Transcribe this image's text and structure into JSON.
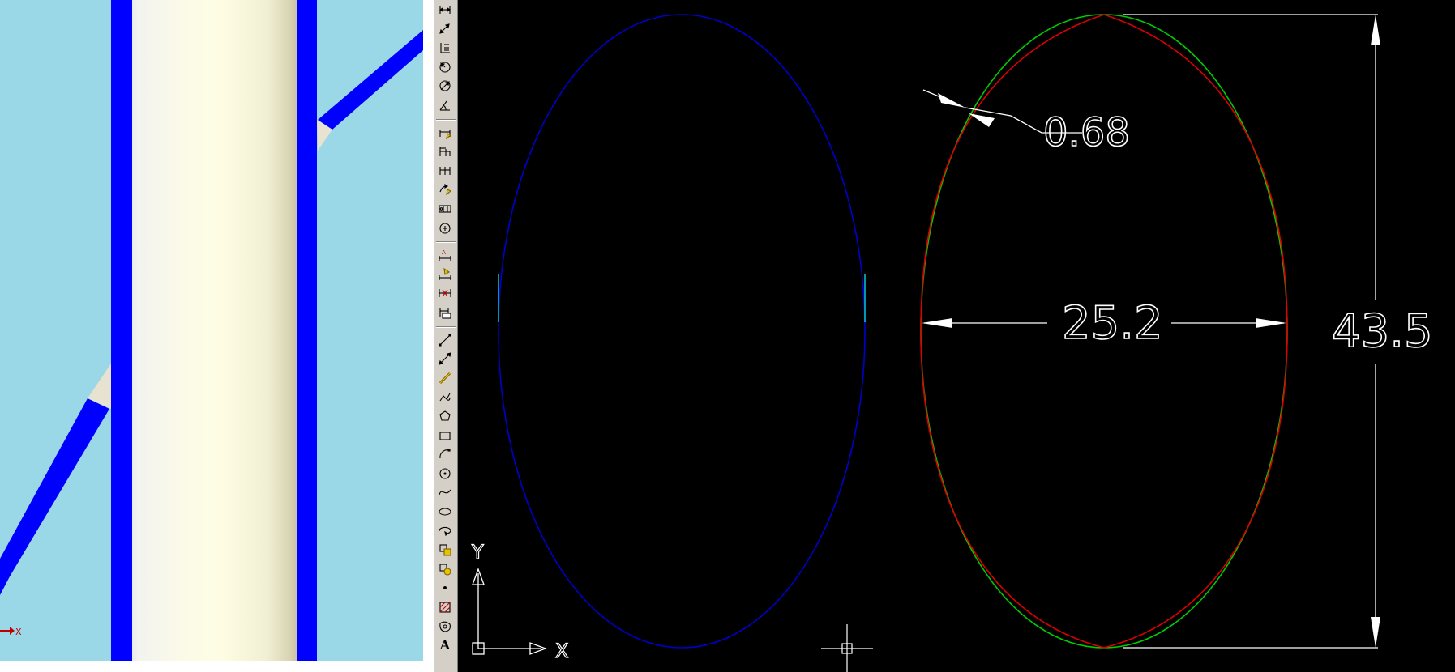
{
  "viewport3d": {
    "background_color": "#9ad8e8",
    "tube_color": "#0000ff",
    "shaft_color": "#fdfce4",
    "axis_label": "X"
  },
  "toolbar": {
    "groups": [
      [
        "dim-linear-icon",
        "dim-aligned-icon",
        "dim-ordinate-icon",
        "dim-radius-icon",
        "dim-diameter-icon",
        "dim-angular-icon"
      ],
      [
        "quick-dim-icon",
        "baseline-dim-icon",
        "continue-dim-icon",
        "quick-leader-icon",
        "tolerance-icon",
        "center-mark-icon"
      ],
      [
        "dim-edit-icon",
        "dim-text-edit-icon",
        "dim-update-icon",
        "dim-style-icon"
      ],
      [
        "line-icon",
        "xline-icon",
        "pline-icon",
        "polyline-icon",
        "polygon-icon",
        "rectangle-icon",
        "arc-icon",
        "circle-icon",
        "spline-icon",
        "ellipse-icon",
        "ellipse-arc-icon",
        "insert-block-icon",
        "make-block-icon",
        "point-icon",
        "hatch-icon",
        "region-icon",
        "mtext-icon"
      ]
    ],
    "mtext_glyph": "A"
  },
  "cad": {
    "background_color": "#000000",
    "ellipse_left_color": "#0000cc",
    "ellipse_green_color": "#00cc00",
    "ellipse_red_color": "#dd0000",
    "dimension_color": "#ffffff",
    "dimensions": {
      "gap": "0.68",
      "width": "25.2",
      "height": "43.5"
    },
    "ucs": {
      "x_label": "X",
      "y_label": "Y"
    }
  }
}
